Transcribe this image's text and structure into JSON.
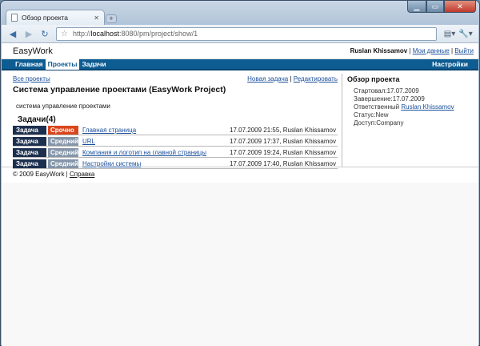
{
  "browser": {
    "tab_title": "Обзор проекта",
    "new_tab": "+",
    "url_prefix": "http://",
    "url_host": "localhost",
    "url_rest": ":8080/pm/project/show/1",
    "icons": [
      "back-icon",
      "forward-icon",
      "reload-icon",
      "star-icon",
      "page-menu-icon",
      "wrench-icon"
    ]
  },
  "header": {
    "brand": "EasyWork",
    "user_name": "Ruslan Khissamov",
    "sep1": " | ",
    "my_data": "Мои данные",
    "sep2": " | ",
    "logout": "Выйти"
  },
  "menu": {
    "home": "Главная",
    "projects": "Проекты",
    "tasks": "Задачи",
    "settings": "Настройки"
  },
  "main": {
    "all_projects": "Все проекты",
    "new_task": "Новая задача",
    "sep": " | ",
    "edit": "Редактировать",
    "title": "Система управление проектами (EasyWork Project)",
    "description": "система управление проектами",
    "tasks_title": "Задачи(4)",
    "tasks": [
      {
        "type": "Задача",
        "priority": "Срочно",
        "name": "Главная страница",
        "meta": "17.07.2009 21:55, Ruslan Khissamov"
      },
      {
        "type": "Задача",
        "priority": "Средний",
        "name": "URL",
        "meta": "17.07.2009 17:37, Ruslan Khissamov"
      },
      {
        "type": "Задача",
        "priority": "Средний",
        "name": "Компания и логотип на главной страницы",
        "meta": "17.07.2009 19:24, Ruslan Khissamov"
      },
      {
        "type": "Задача",
        "priority": "Средний",
        "name": "Настройки системы",
        "meta": "17.07.2009 17:40, Ruslan Khissamov"
      }
    ]
  },
  "side": {
    "title": "Обзор проекта",
    "started": "Стартовал:17.07.2009",
    "finished": "Завершение:17.07.2009",
    "owner_label": "Ответственный ",
    "owner": "Ruslan Khissamov",
    "status": "Статус:New",
    "access": "Доступ:Company"
  },
  "footer": {
    "copyright": "© 2009 EasyWork | ",
    "help": "Справка"
  },
  "colors": {
    "menubar": "#0d5c92",
    "type_badge": "#1c2f4e",
    "urgent": "#d9461c",
    "medium": "#8595a9"
  }
}
